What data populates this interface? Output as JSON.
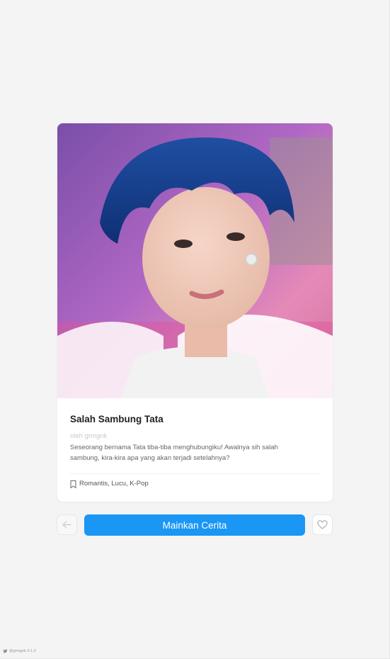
{
  "story": {
    "title": "Salah Sambung Tata",
    "author": "oleh grmgnk",
    "description": "Seseorang bernama Tata tiba-tiba menghubungiku! Awalnya sih salah sambung, kira-kira apa yang akan terjadi setelahnya?",
    "tags": "Romantis, Lucu, K-Pop",
    "cover_image": "portrait photo of a person with blue hair on a pink and purple background"
  },
  "actions": {
    "play_label": "Mainkan Cerita",
    "back_icon": "arrow-left-icon",
    "like_icon": "heart-icon"
  },
  "footer": {
    "credit": "@grmgnk 0.1.0",
    "icon": "twitter-icon"
  },
  "colors": {
    "accent": "#1a96f5",
    "background": "#f4f4f4",
    "card": "#ffffff"
  }
}
